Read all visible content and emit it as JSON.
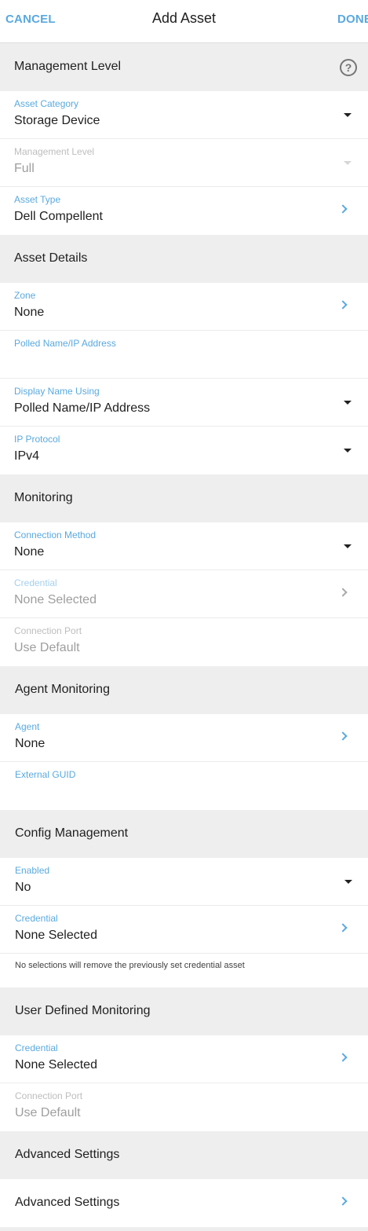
{
  "header": {
    "cancel": "CANCEL",
    "title": "Add Asset",
    "done": "DONE"
  },
  "sections": {
    "management_level": "Management Level",
    "asset_details": "Asset Details",
    "monitoring": "Monitoring",
    "agent_monitoring": "Agent Monitoring",
    "config_management": "Config Management",
    "user_defined_monitoring": "User Defined Monitoring",
    "advanced_settings": "Advanced Settings"
  },
  "help_glyph": "?",
  "fields": {
    "asset_category": {
      "label": "Asset Category",
      "value": "Storage Device"
    },
    "management_level": {
      "label": "Management Level",
      "value": "Full"
    },
    "asset_type": {
      "label": "Asset Type",
      "value": "Dell Compellent"
    },
    "zone": {
      "label": "Zone",
      "value": "None"
    },
    "polled_name": {
      "label": "Polled Name/IP Address",
      "value": ""
    },
    "display_name_using": {
      "label": "Display Name Using",
      "value": "Polled Name/IP Address"
    },
    "ip_protocol": {
      "label": "IP Protocol",
      "value": "IPv4"
    },
    "connection_method": {
      "label": "Connection Method",
      "value": "None"
    },
    "monitoring_credential": {
      "label": "Credential",
      "value": "None Selected"
    },
    "monitoring_connection_port": {
      "label": "Connection Port",
      "value": "Use Default"
    },
    "agent": {
      "label": "Agent",
      "value": "None"
    },
    "external_guid": {
      "label": "External GUID",
      "value": ""
    },
    "config_enabled": {
      "label": "Enabled",
      "value": "No"
    },
    "config_credential": {
      "label": "Credential",
      "value": "None Selected"
    },
    "config_note": "No selections will remove the previously set credential asset",
    "udm_credential": {
      "label": "Credential",
      "value": "None Selected"
    },
    "udm_connection_port": {
      "label": "Connection Port",
      "value": "Use Default"
    },
    "advanced_settings_link": "Advanced Settings"
  },
  "colors": {
    "accent": "#5aa9df",
    "section_bg": "#eeeeee",
    "disabled_text": "#9e9e9e"
  }
}
